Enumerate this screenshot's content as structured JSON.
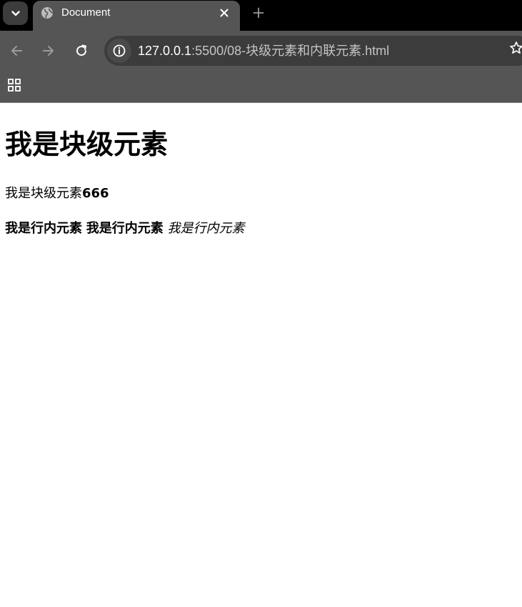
{
  "tab": {
    "title": "Document"
  },
  "address": {
    "host": "127.0.0.1",
    "path": ":5500/08-块级元素和内联元素.html"
  },
  "icons": {
    "tab_search": "chevron-down-icon",
    "favicon": "globe-icon",
    "close": "close-icon",
    "new_tab": "plus-icon",
    "back": "arrow-left-icon",
    "forward": "arrow-right-icon",
    "reload": "reload-icon",
    "site_info": "info-icon",
    "bookmark": "star-icon",
    "apps": "apps-grid-icon"
  },
  "colors": {
    "tabstrip": "#000000",
    "toolbar": "#555555",
    "omnibox": "#3c3c3c",
    "page_background": "#ffffff"
  },
  "content": {
    "heading": "我是块级元素",
    "block_text": "我是块级元素",
    "block_bold": "666",
    "inline_bold_1": "我是行内元素",
    "inline_bold_2": "我是行内元素",
    "inline_italic": "我是行内元素"
  }
}
